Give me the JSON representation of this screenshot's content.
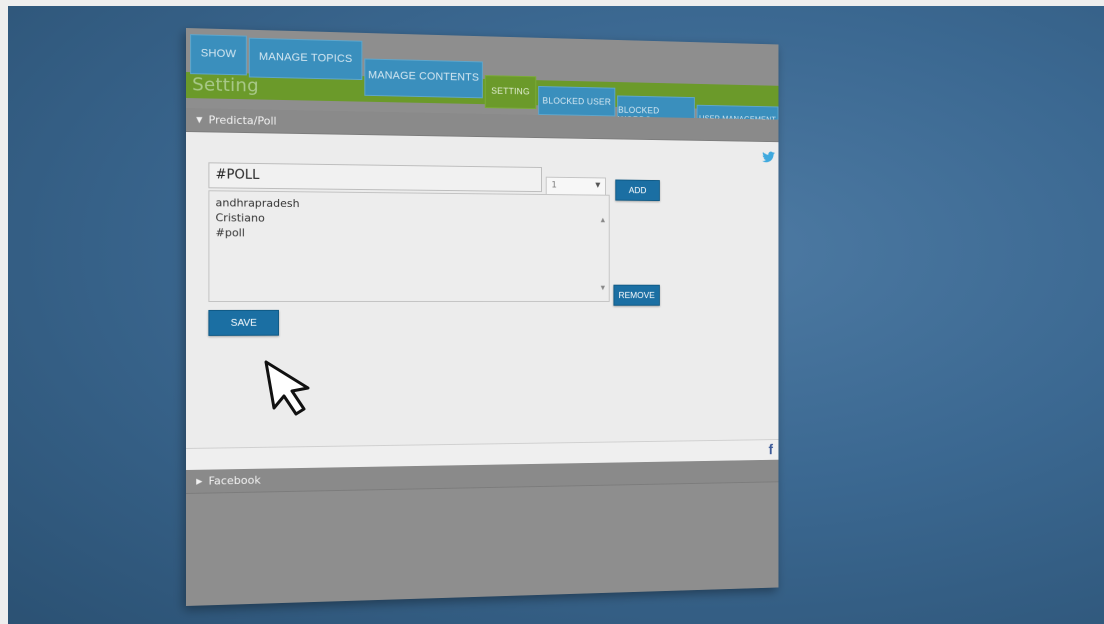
{
  "page": {
    "title": "Setting"
  },
  "tabs": [
    {
      "label": "SHOW",
      "active": false
    },
    {
      "label": "MANAGE TOPICS",
      "active": false
    },
    {
      "label": "MANAGE CONTENTS",
      "active": false
    },
    {
      "label": "SETTING",
      "active": true
    },
    {
      "label": "BLOCKED USER",
      "active": false
    },
    {
      "label": "BLOCKED WORDS",
      "active": false
    },
    {
      "label": "USER MANAGEMENT",
      "active": false
    }
  ],
  "sections": {
    "poll": {
      "label": "Predicta/Poll",
      "expanded": true
    },
    "facebook": {
      "label": "Facebook",
      "expanded": false
    }
  },
  "poll": {
    "hashtag_value": "#POLL",
    "select_value": "1",
    "add_label": "ADD",
    "remove_label": "REMOVE",
    "save_label": "SAVE",
    "items": [
      "andhrapradesh",
      "Cristiano",
      "#poll"
    ]
  },
  "icons": {
    "twitter": "twitter-icon",
    "facebook": "facebook-icon",
    "cursor": "mouse-pointer-icon"
  },
  "colors": {
    "tab_blue": "#3a8fbd",
    "active_green": "#6b9a2a",
    "button_blue": "#1b6fa3",
    "background": "#3b6891"
  }
}
